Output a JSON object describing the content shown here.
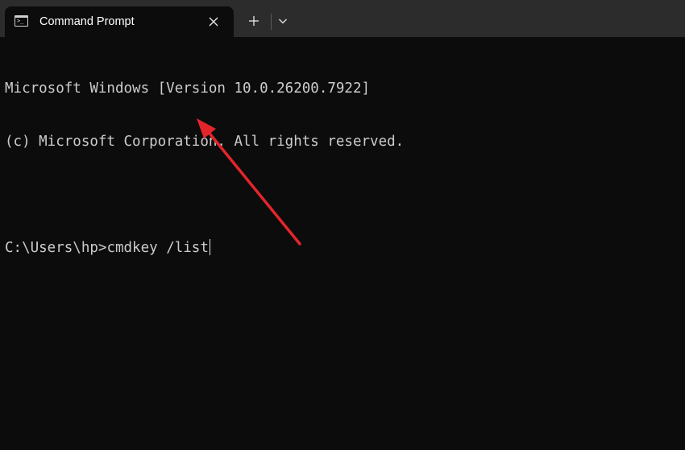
{
  "window": {
    "tab_title": "Command Prompt",
    "tab_icon": "console-icon",
    "close_icon": "close-icon",
    "new_tab_icon": "plus-icon",
    "dropdown_icon": "chevron-down-icon"
  },
  "console": {
    "lines": [
      "Microsoft Windows [Version 10.0.26200.7922]",
      "(c) Microsoft Corporation. All rights reserved.",
      ""
    ],
    "prompt": "C:\\Users\\hp>",
    "command": "cmdkey /list"
  },
  "annotation": {
    "type": "arrow",
    "color": "#e3252b"
  }
}
